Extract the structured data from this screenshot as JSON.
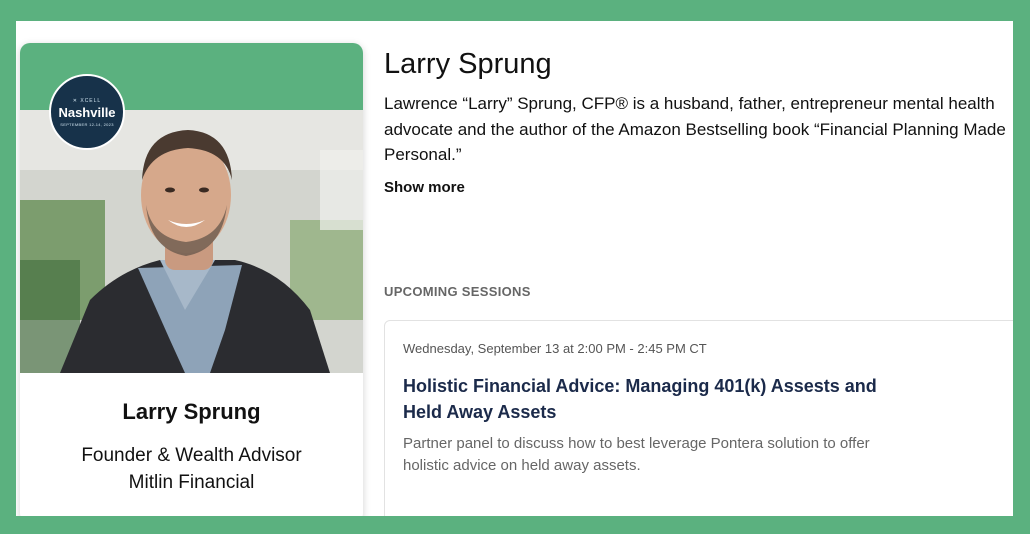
{
  "event_badge": {
    "brand": "✕ XCELL",
    "city": "Nashville",
    "dates": "SEPTEMBER 12-14, 2023"
  },
  "card": {
    "name": "Larry Sprung",
    "title": "Founder & Wealth Advisor",
    "company": "Mitlin Financial"
  },
  "speaker": {
    "name": "Larry Sprung",
    "bio": "Lawrence “Larry” Sprung, CFP® is a husband, father, entrepreneur mental health advocate and the author of the Amazon Bestselling book “Financial Planning Made Personal.”",
    "show_more": "Show more"
  },
  "sessions": {
    "heading": "UPCOMING SESSIONS",
    "items": [
      {
        "time": "Wednesday, September 13 at 2:00 PM - 2:45 PM CT",
        "title": "Holistic Financial Advice: Managing 401(k) Assests and Held Away Assets",
        "description": "Partner panel to discuss how to best leverage Pontera solution to offer holistic advice on held away assets."
      }
    ]
  },
  "colors": {
    "background_green": "#5bb17f",
    "badge_navy": "#17324a",
    "session_title": "#1b2a4a"
  }
}
